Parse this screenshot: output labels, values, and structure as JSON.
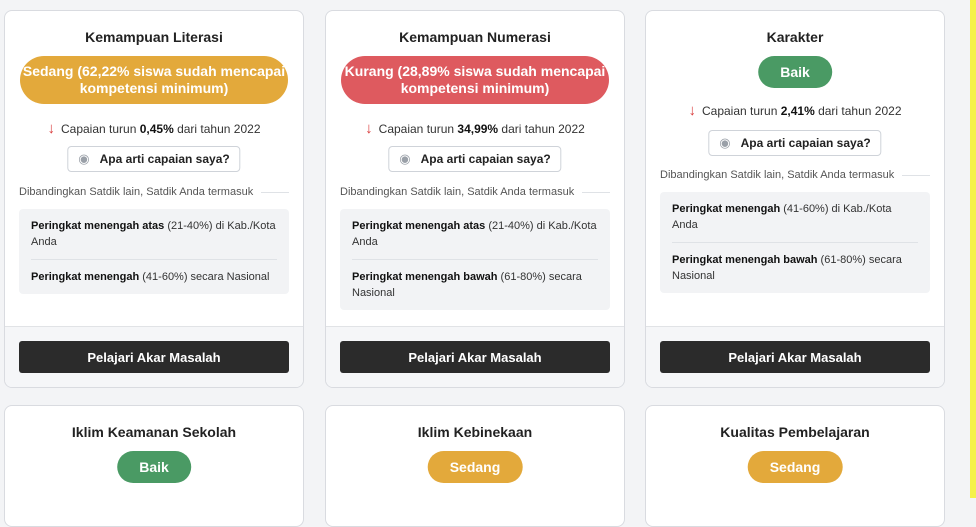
{
  "cards": [
    {
      "title": "Kemampuan Literasi",
      "status": "Sedang (62,22% siswa sudah mencapai kompetensi minimum)",
      "change_pre": "Capaian turun ",
      "change_value": "0,45%",
      "change_post": " dari tahun 2022",
      "help": "Apa arti capaian saya?",
      "compare": "Dibandingkan Satdik lain, Satdik Anda termasuk",
      "rank1_bold": "Peringkat menengah atas",
      "rank1_rest": " (21-40%) di Kab./Kota Anda",
      "rank2_bold": "Peringkat menengah",
      "rank2_rest": " (41-60%) secara Nasional",
      "action": "Pelajari Akar Masalah"
    },
    {
      "title": "Kemampuan Numerasi",
      "status": "Kurang (28,89% siswa sudah mencapai kompetensi minimum)",
      "change_pre": "Capaian turun ",
      "change_value": "34,99%",
      "change_post": " dari tahun 2022",
      "help": "Apa arti capaian saya?",
      "compare": "Dibandingkan Satdik lain, Satdik Anda termasuk",
      "rank1_bold": "Peringkat menengah atas",
      "rank1_rest": " (21-40%) di Kab./Kota Anda",
      "rank2_bold": "Peringkat menengah bawah",
      "rank2_rest": " (61-80%) secara Nasional",
      "action": "Pelajari Akar Masalah"
    },
    {
      "title": "Karakter",
      "status": "Baik",
      "change_pre": "Capaian turun ",
      "change_value": "2,41%",
      "change_post": " dari tahun 2022",
      "help": "Apa arti capaian saya?",
      "compare": "Dibandingkan Satdik lain, Satdik Anda termasuk",
      "rank1_bold": "Peringkat menengah",
      "rank1_rest": " (41-60%) di Kab./Kota Anda",
      "rank2_bold": "Peringkat menengah bawah",
      "rank2_rest": " (61-80%) secara Nasional",
      "action": "Pelajari Akar Masalah"
    },
    {
      "title": "Iklim Keamanan Sekolah",
      "status": "Baik"
    },
    {
      "title": "Iklim Kebinekaan",
      "status": "Sedang"
    },
    {
      "title": "Kualitas Pembelajaran",
      "status": "Sedang"
    }
  ],
  "colors": {
    "sedang": "#e3a93b",
    "kurang": "#de5a5f",
    "baik": "#4a9a64",
    "arrow_down": "#d93c3c",
    "action_button": "#2b2b2b"
  },
  "icons": {
    "change": "arrow-down-icon",
    "help": "eye-icon"
  }
}
